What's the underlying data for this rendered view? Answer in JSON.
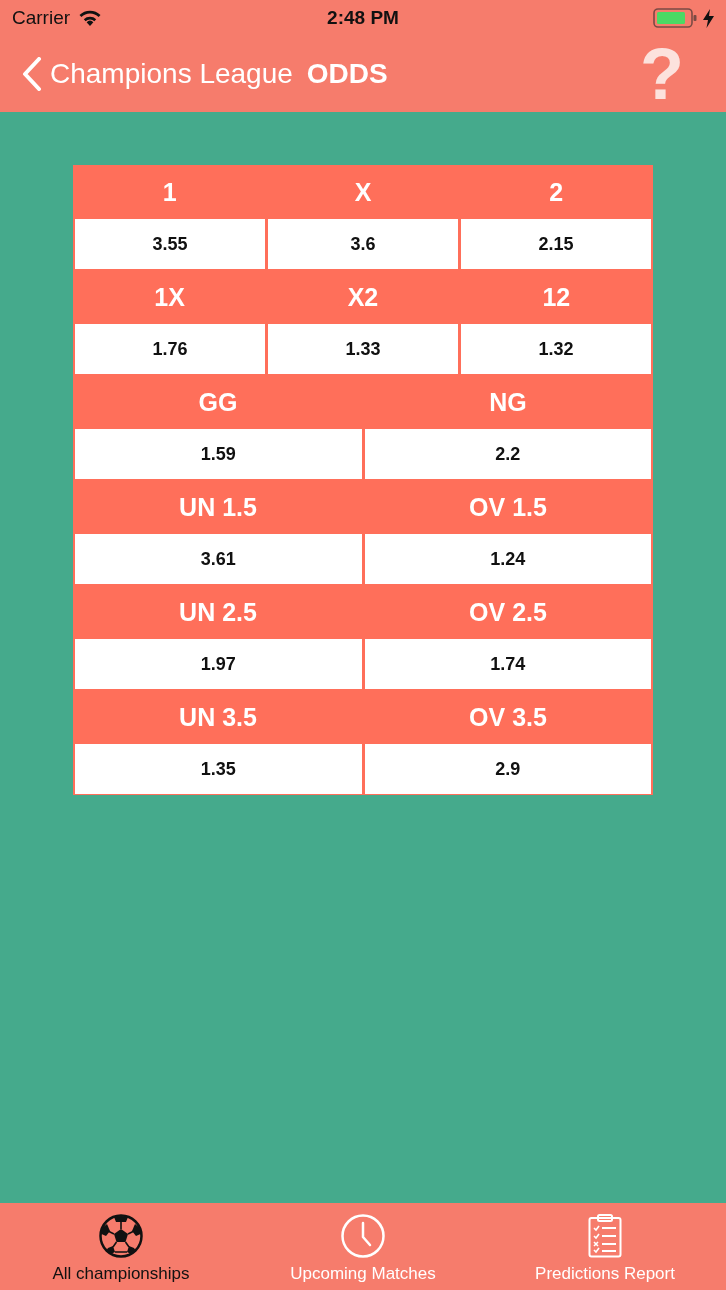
{
  "status_bar": {
    "carrier": "Carrier",
    "time": "2:48 PM"
  },
  "nav_bar": {
    "back_label": "Champions League",
    "title": "ODDS",
    "help": "?"
  },
  "odds_groups": [
    {
      "cells": [
        {
          "label": "1",
          "value": "3.55"
        },
        {
          "label": "X",
          "value": "3.6"
        },
        {
          "label": "2",
          "value": "2.15"
        }
      ]
    },
    {
      "cells": [
        {
          "label": "1X",
          "value": "1.76"
        },
        {
          "label": "X2",
          "value": "1.33"
        },
        {
          "label": "12",
          "value": "1.32"
        }
      ]
    },
    {
      "cells": [
        {
          "label": "GG",
          "value": "1.59"
        },
        {
          "label": "NG",
          "value": "2.2"
        }
      ]
    },
    {
      "cells": [
        {
          "label": "UN 1.5",
          "value": "3.61"
        },
        {
          "label": "OV 1.5",
          "value": "1.24"
        }
      ]
    },
    {
      "cells": [
        {
          "label": "UN 2.5",
          "value": "1.97"
        },
        {
          "label": "OV 2.5",
          "value": "1.74"
        }
      ]
    },
    {
      "cells": [
        {
          "label": "UN 3.5",
          "value": "1.35"
        },
        {
          "label": "OV 3.5",
          "value": "2.9"
        }
      ]
    }
  ],
  "tab_bar": {
    "items": [
      {
        "kind": "ball",
        "label": "All championships",
        "selected": true
      },
      {
        "kind": "clock",
        "label": "Upcoming Matches",
        "selected": false
      },
      {
        "kind": "report",
        "label": "Predictions Report",
        "selected": false
      }
    ]
  }
}
